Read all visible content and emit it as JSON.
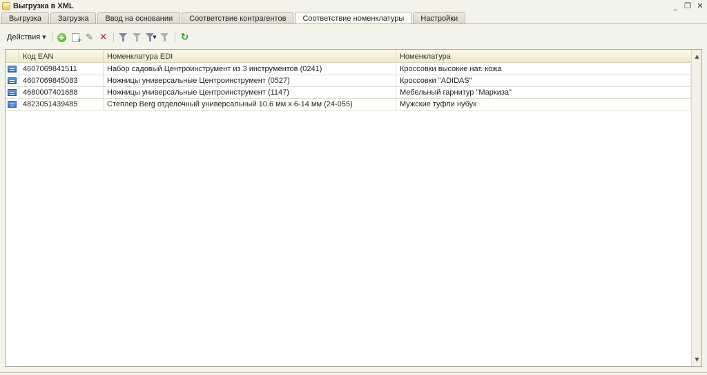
{
  "window": {
    "title": "Выгрузка  в XML",
    "minimize_glyph": "_",
    "restore_glyph": "❐",
    "close_glyph": "✕"
  },
  "tabs": [
    {
      "label": "Выгрузка",
      "active": false
    },
    {
      "label": "Загрузка",
      "active": false
    },
    {
      "label": "Ввод на основании",
      "active": false
    },
    {
      "label": "Соответствие контрагентов",
      "active": false
    },
    {
      "label": "Соответствие номенклатуры",
      "active": true
    },
    {
      "label": "Настройки",
      "active": false
    }
  ],
  "toolbar": {
    "actions_label": "Действия",
    "icons": [
      "add-icon",
      "copy-icon",
      "edit-icon",
      "delete-icon",
      "filter-icon",
      "filter-list-icon",
      "filter-dropdown-icon",
      "filter-clear-icon",
      "refresh-icon"
    ]
  },
  "table": {
    "columns": [
      "Код EAN",
      "Номенклатура EDI",
      "Номенклатура"
    ],
    "rows": [
      {
        "ean": "4607069841511",
        "edi": "Набор садовый Центроинструмент из 3 инструментов (0241)",
        "item": "Кроссовки высокие нат. кожа"
      },
      {
        "ean": "4607069845083",
        "edi": "Ножницы универсальные Центроинструмент (0527)",
        "item": "Кроссовки \"ADIDAS\""
      },
      {
        "ean": "4680007401688",
        "edi": "Ножницы универсальные Центроинструмент (1147)",
        "item": "Мебельный гарнитур \"Маркиза\""
      },
      {
        "ean": "4823051439485",
        "edi": "Степлер Berg отделочный универсальный 10.6 мм х 6-14 мм (24-055)",
        "item": "Мужские туфли нубук"
      }
    ]
  },
  "colors": {
    "accent_row_icon": "#2f6cc0",
    "delete": "#dd2222",
    "add": "#3c9a28"
  }
}
